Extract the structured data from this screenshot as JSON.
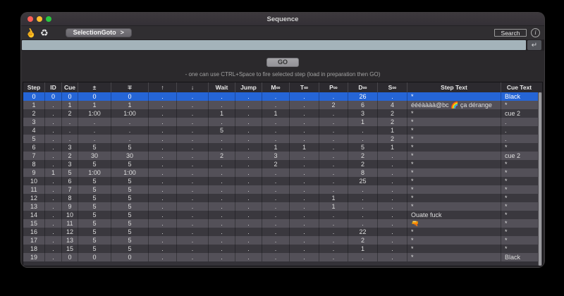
{
  "window": {
    "title": "Sequence"
  },
  "toolbar": {
    "selection_goto": "SelectionGoto",
    "chevron": ">",
    "search": "Search",
    "info": "i"
  },
  "icons": {
    "hand": "☝",
    "recycle": "♻",
    "return": "↵"
  },
  "command_bar": {
    "value": ""
  },
  "go_button": "GO",
  "hint": "- one can use CTRL+Space to fire selected step (load in preparation then GO)",
  "table": {
    "selected_row": 0,
    "columns": [
      "Step",
      "ID",
      "Cue",
      "±",
      "∓",
      "↑",
      "↓",
      "Wait",
      "Jump",
      "M∞",
      "T∞",
      "P∞",
      "D∞",
      "S∞",
      "Step Text",
      "Cue Text"
    ],
    "rows": [
      [
        "0",
        "0",
        "0",
        "0",
        "0",
        ".",
        ".",
        ".",
        ".",
        ".",
        ".",
        ".",
        "26",
        ".",
        "*",
        "Black"
      ],
      [
        "1",
        ".",
        "1",
        "1",
        "1",
        ".",
        ".",
        ".",
        ".",
        ".",
        ".",
        "2",
        "6",
        "4",
        "éééàààà@bc 🌈 ça dérange",
        "*"
      ],
      [
        "2",
        ".",
        "2",
        "1:00",
        "1:00",
        ".",
        ".",
        "1",
        ".",
        "1",
        ".",
        ".",
        "3",
        "2",
        "*",
        "cue 2"
      ],
      [
        "3",
        ".",
        ".",
        ".",
        ".",
        ".",
        ".",
        ".",
        ".",
        ".",
        ".",
        ".",
        "1",
        "2",
        "*",
        "."
      ],
      [
        "4",
        ".",
        ".",
        ".",
        ".",
        ".",
        ".",
        "5",
        ".",
        ".",
        ".",
        ".",
        ".",
        "1",
        "*",
        "."
      ],
      [
        "5",
        ".",
        ".",
        ".",
        ".",
        ".",
        ".",
        ".",
        ".",
        ".",
        ".",
        ".",
        ".",
        "2",
        "*",
        "."
      ],
      [
        "6",
        ".",
        "3",
        "5",
        "5",
        ".",
        ".",
        ".",
        ".",
        "1",
        "1",
        ".",
        "5",
        "1",
        "*",
        "*"
      ],
      [
        "7",
        ".",
        "2",
        "30",
        "30",
        ".",
        ".",
        "2",
        ".",
        "3",
        ".",
        ".",
        "2",
        ".",
        "*",
        "cue 2"
      ],
      [
        "8",
        ".",
        "3",
        "5",
        "5",
        ".",
        ".",
        ".",
        ".",
        "2",
        ".",
        ".",
        "2",
        ".",
        "*",
        "*"
      ],
      [
        "9",
        "1",
        "5",
        "1:00",
        "1:00",
        ".",
        ".",
        ".",
        ".",
        ".",
        ".",
        ".",
        "8",
        ".",
        "*",
        "*"
      ],
      [
        "10",
        ".",
        "6",
        "5",
        "5",
        ".",
        ".",
        ".",
        ".",
        ".",
        ".",
        ".",
        "25",
        ".",
        "*",
        "*"
      ],
      [
        "11",
        ".",
        "7",
        "5",
        "5",
        ".",
        ".",
        ".",
        ".",
        ".",
        ".",
        ".",
        ".",
        ".",
        "*",
        "*"
      ],
      [
        "12",
        ".",
        "8",
        "5",
        "5",
        ".",
        ".",
        ".",
        ".",
        ".",
        ".",
        "1",
        ".",
        ".",
        "*",
        "*"
      ],
      [
        "13",
        ".",
        "9",
        "5",
        "5",
        ".",
        ".",
        ".",
        ".",
        ".",
        ".",
        "1",
        ".",
        ".",
        "*",
        "*"
      ],
      [
        "14",
        ".",
        "10",
        "5",
        "5",
        ".",
        ".",
        ".",
        ".",
        ".",
        ".",
        ".",
        ".",
        ".",
        "Ouate fuck",
        "*"
      ],
      [
        "15",
        ".",
        "11",
        "5",
        "5",
        ".",
        ".",
        ".",
        ".",
        ".",
        ".",
        ".",
        ".",
        ".",
        "🔫",
        "*"
      ],
      [
        "16",
        ".",
        "12",
        "5",
        "5",
        ".",
        ".",
        ".",
        ".",
        ".",
        ".",
        ".",
        "22",
        ".",
        "*",
        "*"
      ],
      [
        "17",
        ".",
        "13",
        "5",
        "5",
        ".",
        ".",
        ".",
        ".",
        ".",
        ".",
        ".",
        "2",
        ".",
        "*",
        "*"
      ],
      [
        "18",
        ".",
        "15",
        "5",
        "5",
        ".",
        ".",
        ".",
        ".",
        ".",
        ".",
        ".",
        "1",
        ".",
        "*",
        "*"
      ],
      [
        "19",
        ".",
        "0",
        "0",
        "0",
        ".",
        ".",
        ".",
        ".",
        ".",
        ".",
        ".",
        ".",
        ".",
        "*",
        "Black"
      ]
    ]
  },
  "colors": {
    "selection": "#2565d6",
    "command_bar": "#a4b3ba",
    "traffic_close": "#ff5f57",
    "traffic_min": "#febc2e",
    "traffic_zoom": "#28c840"
  }
}
